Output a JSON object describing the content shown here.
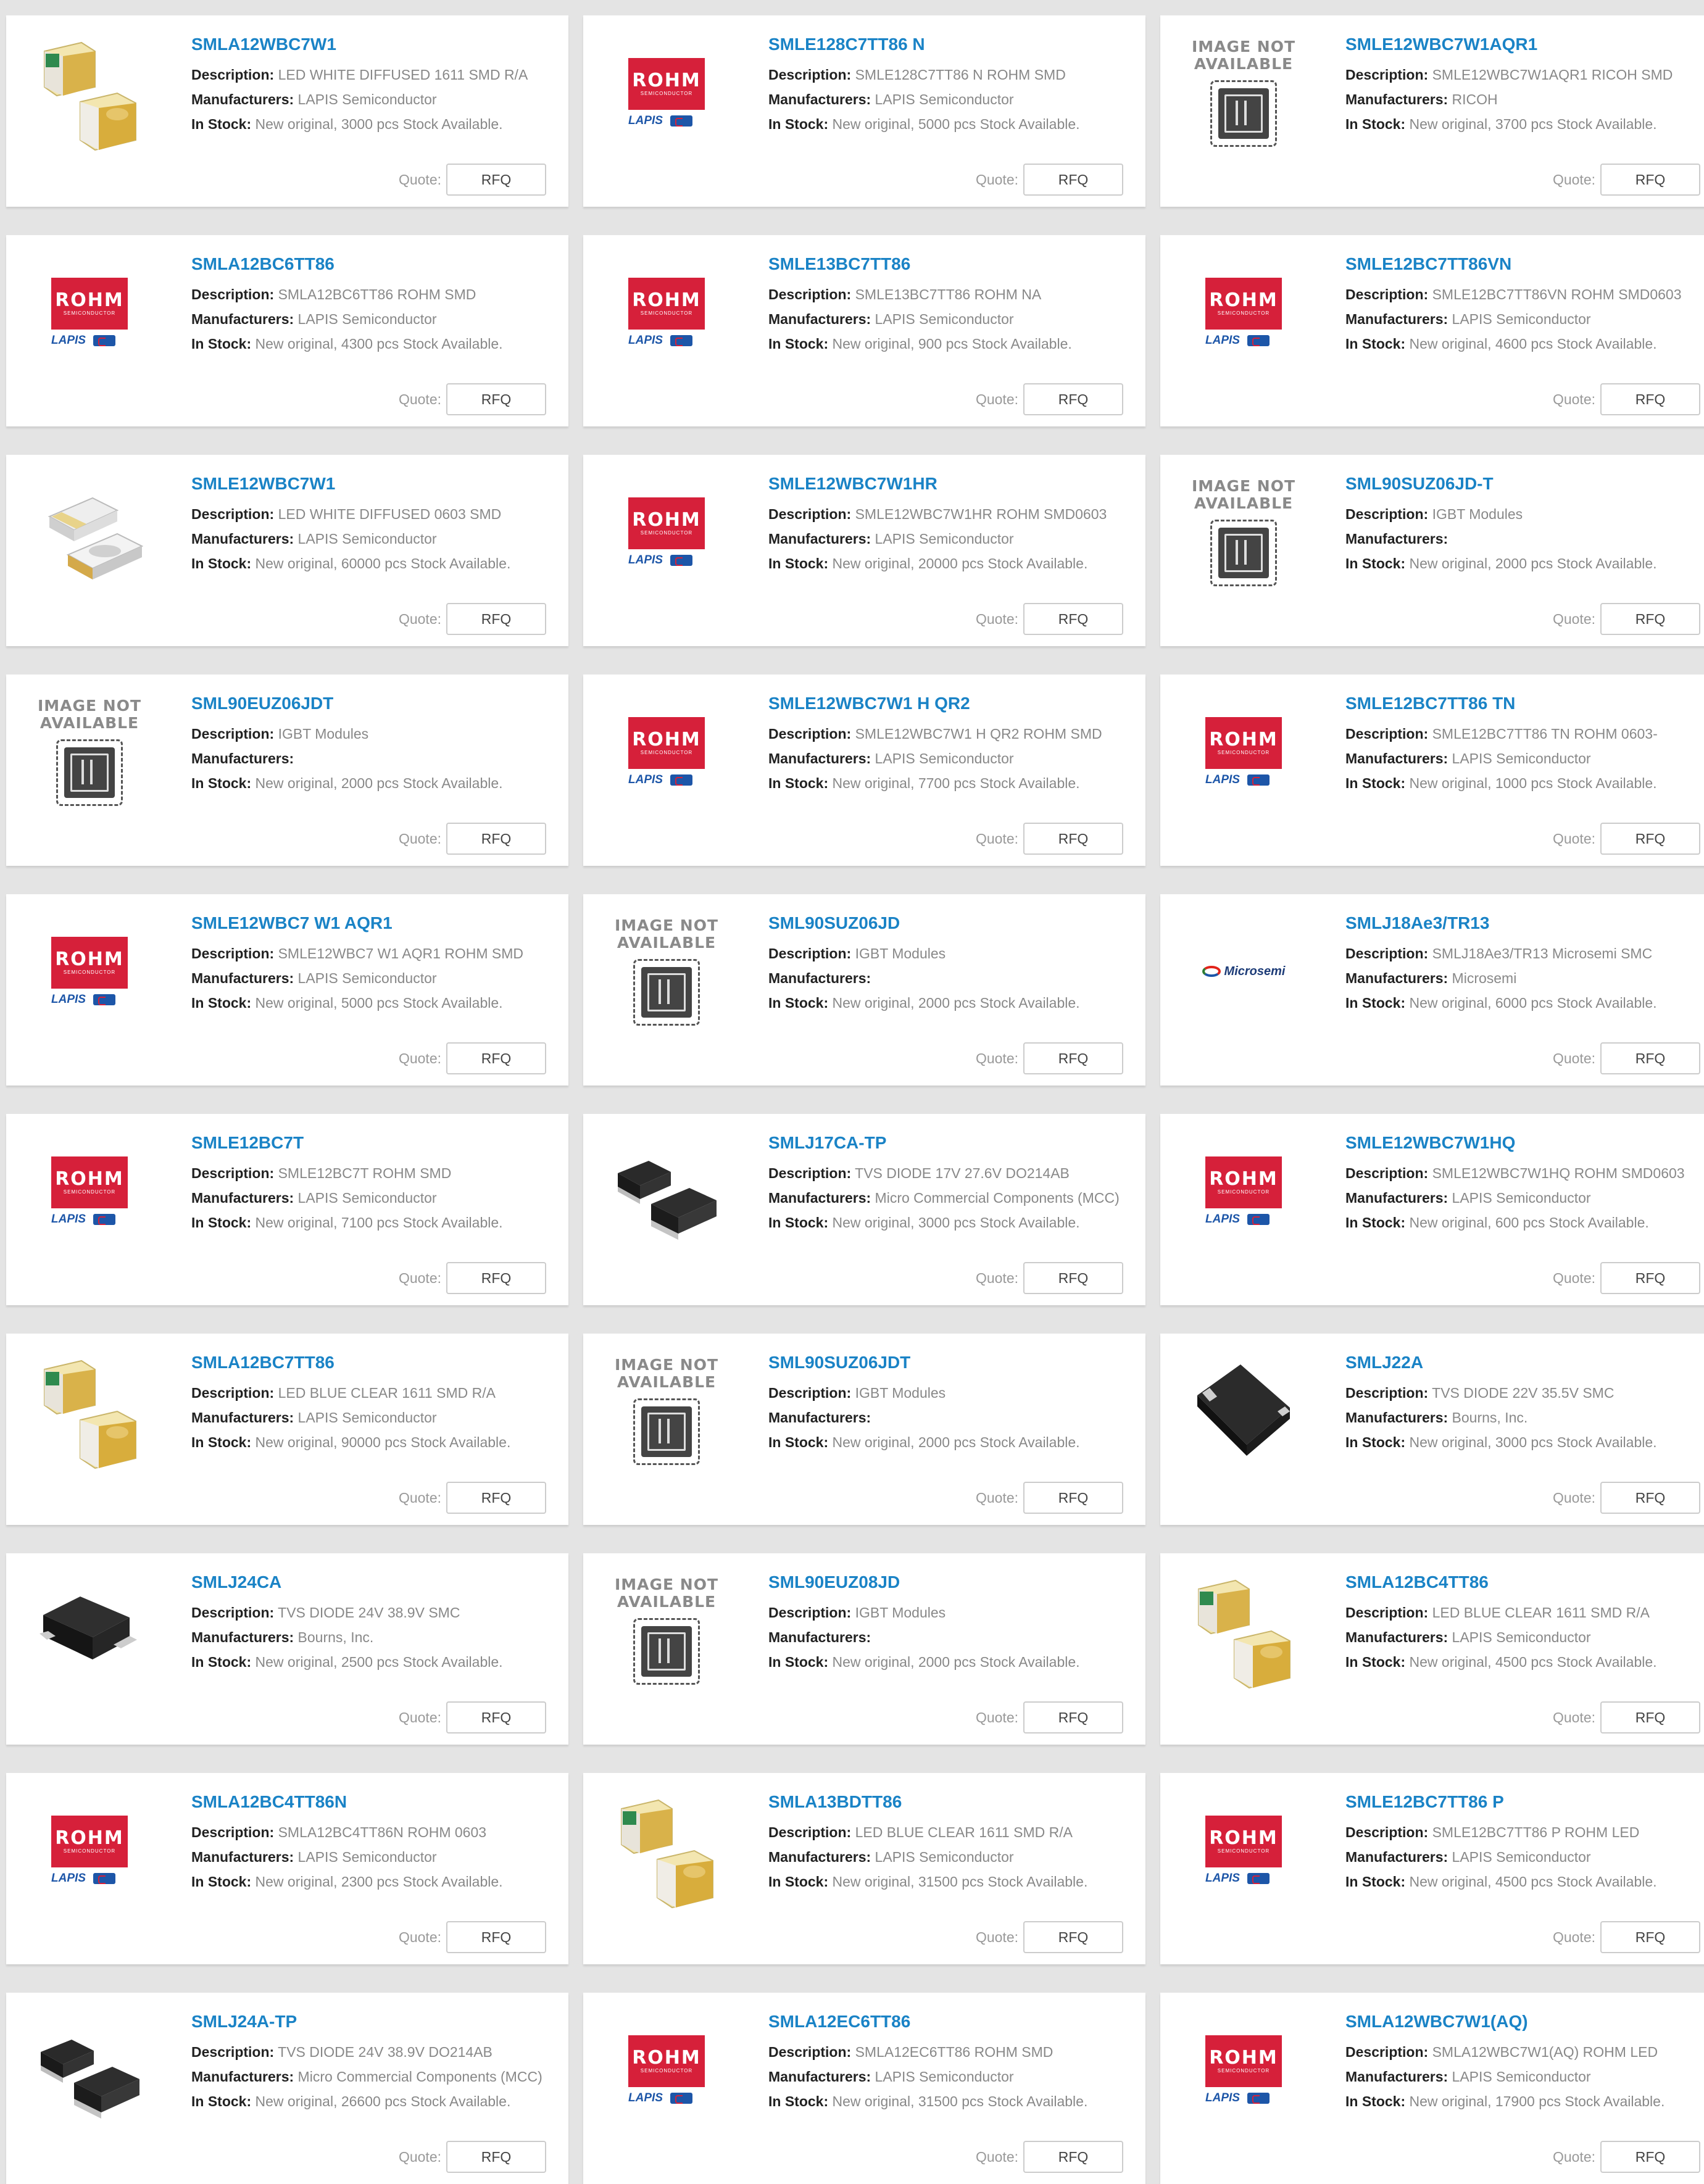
{
  "labels": {
    "description": "Description:",
    "manufacturers": "Manufacturers:",
    "in_stock": "In Stock:",
    "quote": "Quote:",
    "rfq": "RFQ"
  },
  "logos": {
    "rohm": "ROHM",
    "rohm_sub": "SEMICONDUCTOR",
    "lapis": "LAPIS",
    "microsemi": "Microsemi",
    "image_not_available_line1": "IMAGE NOT",
    "image_not_available_line2": "AVAILABLE"
  },
  "colors": {
    "background": "#e4e4e4",
    "card": "#ffffff",
    "link": "#1a83c6",
    "rohm_red": "#d6203a",
    "lapis_blue": "#1d56a8"
  },
  "products": [
    {
      "name": "SMLA12WBC7W1",
      "description": "LED WHITE DIFFUSED 1611 SMD R/A",
      "manufacturer": "LAPIS Semiconductor",
      "stock": "New original, 3000 pcs Stock Available.",
      "image": "led-right-angle-image"
    },
    {
      "name": "SMLE128C7TT86 N",
      "description": "SMLE128C7TT86 N ROHM SMD",
      "manufacturer": "LAPIS Semiconductor",
      "stock": "New original, 5000 pcs Stock Available.",
      "image": "rohm-logo"
    },
    {
      "name": "SMLE12WBC7W1AQR1",
      "description": "SMLE12WBC7W1AQR1 RICOH SMD",
      "manufacturer": "RICOH",
      "stock": "New original, 3700 pcs Stock Available.",
      "image": "image-not-available"
    },
    {
      "name": "SMLA12BC6TT86",
      "description": "SMLA12BC6TT86 ROHM SMD",
      "manufacturer": "LAPIS Semiconductor",
      "stock": "New original, 4300 pcs Stock Available.",
      "image": "rohm-logo"
    },
    {
      "name": "SMLE13BC7TT86",
      "description": "SMLE13BC7TT86 ROHM NA",
      "manufacturer": "LAPIS Semiconductor",
      "stock": "New original, 900 pcs Stock Available.",
      "image": "rohm-logo"
    },
    {
      "name": "SMLE12BC7TT86VN",
      "description": "SMLE12BC7TT86VN ROHM SMD0603",
      "manufacturer": "LAPIS Semiconductor",
      "stock": "New original, 4600 pcs Stock Available.",
      "image": "rohm-logo"
    },
    {
      "name": "SMLE12WBC7W1",
      "description": "LED WHITE DIFFUSED 0603 SMD",
      "manufacturer": "LAPIS Semiconductor",
      "stock": "New original, 60000 pcs Stock Available.",
      "image": "led-0603-image"
    },
    {
      "name": "SMLE12WBC7W1HR",
      "description": "SMLE12WBC7W1HR ROHM SMD0603",
      "manufacturer": "LAPIS Semiconductor",
      "stock": "New original, 20000 pcs Stock Available.",
      "image": "rohm-logo"
    },
    {
      "name": "SML90SUZ06JD-T",
      "description": "IGBT Modules",
      "manufacturer": "",
      "stock": "New original, 2000 pcs Stock Available.",
      "image": "image-not-available"
    },
    {
      "name": "SML90EUZ06JDT",
      "description": "IGBT Modules",
      "manufacturer": "",
      "stock": "New original, 2000 pcs Stock Available.",
      "image": "image-not-available"
    },
    {
      "name": "SMLE12WBC7W1 H QR2",
      "description": "SMLE12WBC7W1 H QR2 ROHM SMD",
      "manufacturer": "LAPIS Semiconductor",
      "stock": "New original, 7700 pcs Stock Available.",
      "image": "rohm-logo"
    },
    {
      "name": "SMLE12BC7TT86 TN",
      "description": "SMLE12BC7TT86 TN ROHM 0603-",
      "manufacturer": "LAPIS Semiconductor",
      "stock": "New original, 1000 pcs Stock Available.",
      "image": "rohm-logo"
    },
    {
      "name": "SMLE12WBC7 W1 AQR1",
      "description": "SMLE12WBC7 W1 AQR1 ROHM SMD",
      "manufacturer": "LAPIS Semiconductor",
      "stock": "New original, 5000 pcs Stock Available.",
      "image": "rohm-logo"
    },
    {
      "name": "SML90SUZ06JD",
      "description": "IGBT Modules",
      "manufacturer": "",
      "stock": "New original, 2000 pcs Stock Available.",
      "image": "image-not-available"
    },
    {
      "name": "SMLJ18Ae3/TR13",
      "description": "SMLJ18Ae3/TR13 Microsemi SMC",
      "manufacturer": "Microsemi",
      "stock": "New original, 6000 pcs Stock Available.",
      "image": "microsemi-logo"
    },
    {
      "name": "SMLE12BC7T",
      "description": "SMLE12BC7T ROHM SMD",
      "manufacturer": "LAPIS Semiconductor",
      "stock": "New original, 7100 pcs Stock Available.",
      "image": "rohm-logo"
    },
    {
      "name": "SMLJ17CA-TP",
      "description": "TVS DIODE 17V 27.6V DO214AB",
      "manufacturer": "Micro Commercial Components (MCC)",
      "stock": "New original, 3000 pcs Stock Available.",
      "image": "diode-do214-image"
    },
    {
      "name": "SMLE12WBC7W1HQ",
      "description": "SMLE12WBC7W1HQ ROHM SMD0603",
      "manufacturer": "LAPIS Semiconductor",
      "stock": "New original, 600 pcs Stock Available.",
      "image": "rohm-logo"
    },
    {
      "name": "SMLA12BC7TT86",
      "description": "LED BLUE CLEAR 1611 SMD R/A",
      "manufacturer": "LAPIS Semiconductor",
      "stock": "New original, 90000 pcs Stock Available.",
      "image": "led-right-angle-image"
    },
    {
      "name": "SML90SUZ06JDT",
      "description": "IGBT Modules",
      "manufacturer": "",
      "stock": "New original, 2000 pcs Stock Available.",
      "image": "image-not-available"
    },
    {
      "name": "SMLJ22A",
      "description": "TVS DIODE 22V 35.5V SMC",
      "manufacturer": "Bourns, Inc.",
      "stock": "New original, 3000 pcs Stock Available.",
      "image": "diode-smc-image"
    },
    {
      "name": "SMLJ24CA",
      "description": "TVS DIODE 24V 38.9V SMC",
      "manufacturer": "Bourns, Inc.",
      "stock": "New original, 2500 pcs Stock Available.",
      "image": "diode-smc-side-image"
    },
    {
      "name": "SML90EUZ08JD",
      "description": "IGBT Modules",
      "manufacturer": "",
      "stock": "New original, 2000 pcs Stock Available.",
      "image": "image-not-available"
    },
    {
      "name": "SMLA12BC4TT86",
      "description": "LED BLUE CLEAR 1611 SMD R/A",
      "manufacturer": "LAPIS Semiconductor",
      "stock": "New original, 4500 pcs Stock Available.",
      "image": "led-right-angle-image"
    },
    {
      "name": "SMLA12BC4TT86N",
      "description": "SMLA12BC4TT86N ROHM 0603",
      "manufacturer": "LAPIS Semiconductor",
      "stock": "New original, 2300 pcs Stock Available.",
      "image": "rohm-logo"
    },
    {
      "name": "SMLA13BDTT86",
      "description": "LED BLUE CLEAR 1611 SMD R/A",
      "manufacturer": "LAPIS Semiconductor",
      "stock": "New original, 31500 pcs Stock Available.",
      "image": "led-right-angle-image"
    },
    {
      "name": "SMLE12BC7TT86 P",
      "description": "SMLE12BC7TT86 P ROHM LED",
      "manufacturer": "LAPIS Semiconductor",
      "stock": "New original, 4500 pcs Stock Available.",
      "image": "rohm-logo"
    },
    {
      "name": "SMLJ24A-TP",
      "description": "TVS DIODE 24V 38.9V DO214AB",
      "manufacturer": "Micro Commercial Components (MCC)",
      "stock": "New original, 26600 pcs Stock Available.",
      "image": "diode-do214-image"
    },
    {
      "name": "SMLA12EC6TT86",
      "description": "SMLA12EC6TT86 ROHM SMD",
      "manufacturer": "LAPIS Semiconductor",
      "stock": "New original, 31500 pcs Stock Available.",
      "image": "rohm-logo"
    },
    {
      "name": "SMLA12WBC7W1(AQ)",
      "description": "SMLA12WBC7W1(AQ) ROHM LED",
      "manufacturer": "LAPIS Semiconductor",
      "stock": "New original, 17900 pcs Stock Available.",
      "image": "rohm-logo"
    }
  ]
}
